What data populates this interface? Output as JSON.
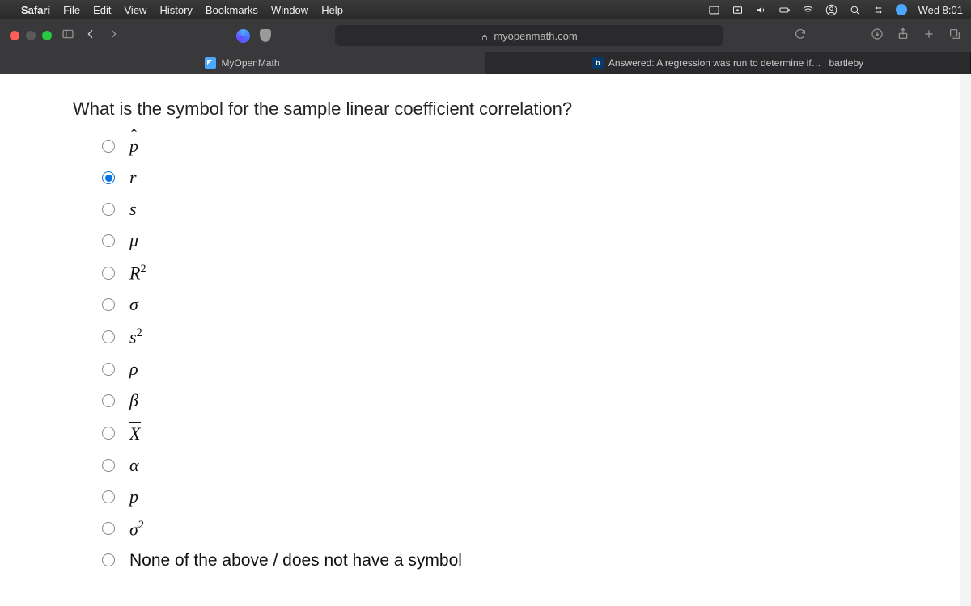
{
  "menubar": {
    "app": "Safari",
    "items": [
      "File",
      "Edit",
      "View",
      "History",
      "Bookmarks",
      "Window",
      "Help"
    ],
    "clock": "Wed 8:01"
  },
  "toolbar": {
    "url": "myopenmath.com"
  },
  "tabs": [
    {
      "label": "MyOpenMath",
      "active": true
    },
    {
      "label": "Answered: A regression was run to determine if… | bartleby",
      "active": false
    }
  ],
  "question": "What is the symbol for the sample linear coefficient correlation?",
  "options": [
    {
      "id": "phat",
      "type": "math",
      "html": "<span class='hat'>p</span>",
      "selected": false
    },
    {
      "id": "r",
      "type": "math",
      "html": "r",
      "selected": true
    },
    {
      "id": "s",
      "type": "math",
      "html": "s",
      "selected": false
    },
    {
      "id": "mu",
      "type": "math",
      "html": "μ",
      "selected": false
    },
    {
      "id": "R2",
      "type": "math",
      "html": "R<sup>2</sup>",
      "selected": false
    },
    {
      "id": "sigma",
      "type": "math",
      "html": "σ",
      "selected": false
    },
    {
      "id": "s2",
      "type": "math",
      "html": "s<sup>2</sup>",
      "selected": false
    },
    {
      "id": "rho",
      "type": "math",
      "html": "ρ",
      "selected": false
    },
    {
      "id": "beta",
      "type": "math",
      "html": "β",
      "selected": false
    },
    {
      "id": "xbar",
      "type": "math",
      "html": "<span class='bar'>X</span>",
      "selected": false
    },
    {
      "id": "alpha",
      "type": "math",
      "html": "α",
      "selected": false
    },
    {
      "id": "p",
      "type": "math",
      "html": "p",
      "selected": false
    },
    {
      "id": "sigma2",
      "type": "math",
      "html": "σ<sup>2</sup>",
      "selected": false
    },
    {
      "id": "none",
      "type": "plain",
      "html": "None of the above / does not have a symbol",
      "selected": false
    }
  ]
}
